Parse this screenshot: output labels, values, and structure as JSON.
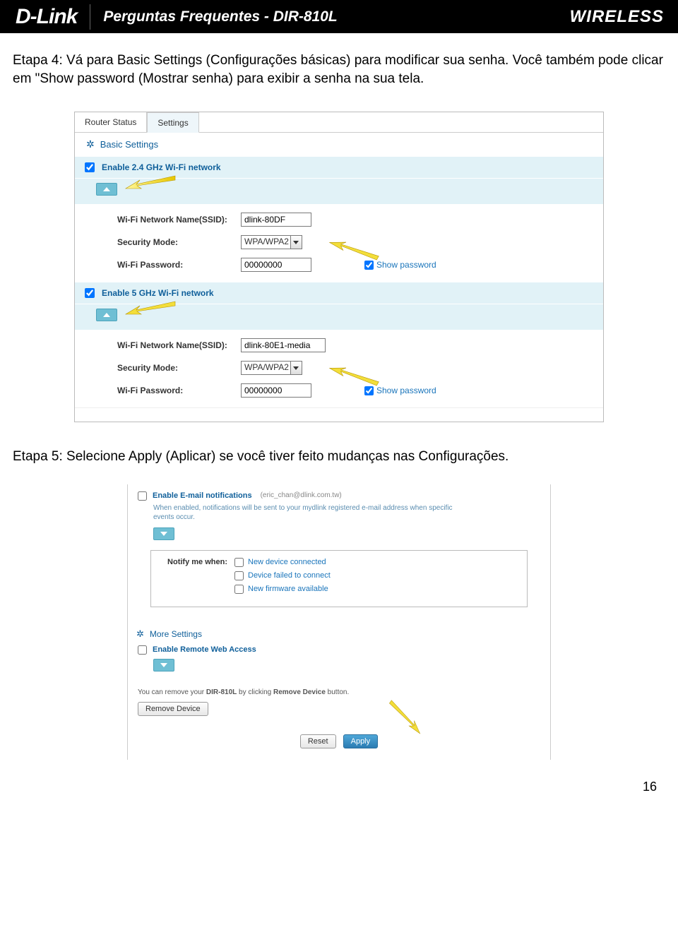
{
  "header": {
    "brand": "D-Link",
    "title": "Perguntas Frequentes - DIR-810L",
    "wireless": "WIRELESS"
  },
  "intro": {
    "step4": "Etapa 4: Vá para Basic Settings (Configurações básicas) para modificar sua senha. Você também pode clicar em  \"Show password (Mostrar senha) para exibir a senha na sua tela.",
    "step5": "Etapa 5: Selecione Apply (Aplicar) se você tiver feito mudanças nas Configurações."
  },
  "shot1": {
    "tabs": [
      "Router Status",
      "Settings"
    ],
    "section": "Basic Settings",
    "g24": {
      "enable": "Enable 2.4 GHz Wi-Fi network",
      "ssid_label": "Wi-Fi Network Name(SSID):",
      "ssid": "dlink-80DF",
      "mode_label": "Security Mode:",
      "mode": "WPA/WPA2",
      "pw_label": "Wi-Fi Password:",
      "pw": "00000000",
      "show": "Show password"
    },
    "g5": {
      "enable": "Enable 5 GHz Wi-Fi network",
      "ssid_label": "Wi-Fi Network Name(SSID):",
      "ssid": "dlink-80E1-media",
      "mode_label": "Security Mode:",
      "mode": "WPA/WPA2",
      "pw_label": "Wi-Fi Password:",
      "pw": "00000000",
      "show": "Show password"
    }
  },
  "shot2": {
    "email_enable": "Enable E-mail notifications",
    "email_sub": "(eric_chan@dlink.com.tw)",
    "email_desc": "When enabled, notifications will be sent to your mydlink registered e-mail address when specific events occur.",
    "notify_label": "Notify me when:",
    "opts": [
      "New device connected",
      "Device failed to connect",
      "New firmware available"
    ],
    "more": "More Settings",
    "remote": "Enable Remote Web Access",
    "remove_text_a": "You can remove your ",
    "remove_text_b": "DIR-810L",
    "remove_text_c": " by clicking ",
    "remove_text_d": "Remove Device",
    "remove_text_e": " button.",
    "remove_btn": "Remove Device",
    "reset": "Reset",
    "apply": "Apply"
  },
  "page": "16"
}
